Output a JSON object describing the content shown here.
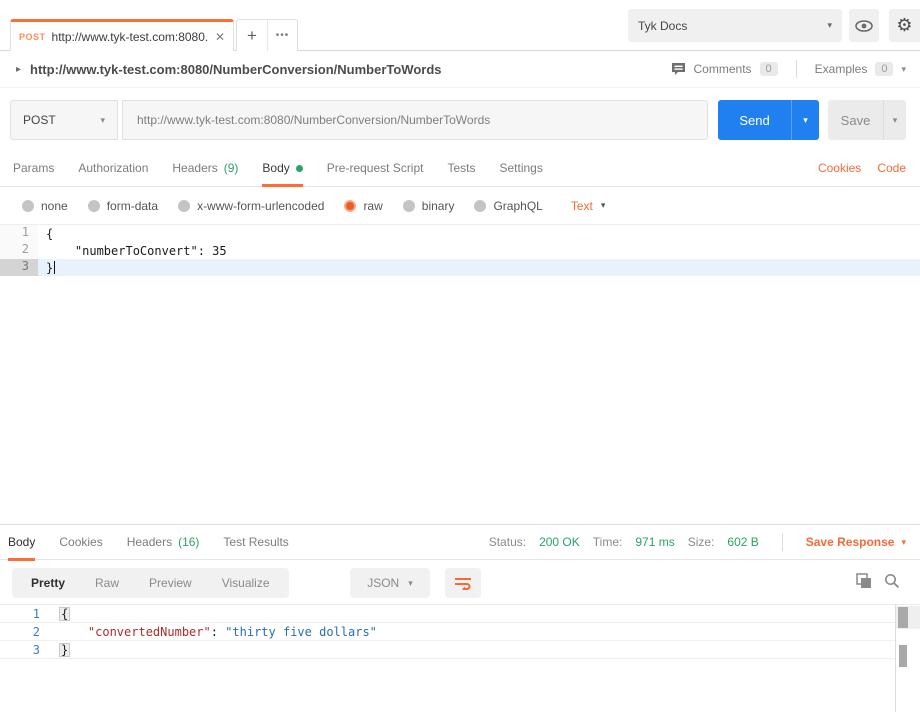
{
  "colors": {
    "accent_orange": "#ff6c37",
    "send_blue": "#2180f0",
    "status_green": "#29a465",
    "json_key_red": "#b22b27",
    "json_string_blue": "#2a6db5",
    "line_number_blue": "#3f7cac"
  },
  "icons": {
    "close": "✕",
    "plus": "+",
    "more": "•••",
    "caret": "▾",
    "arrow": "▸",
    "gear": "⚙"
  },
  "topbar": {
    "tab_method": "POST",
    "tab_title": "http://www.tyk-test.com:8080...",
    "workspace": "Tyk Docs"
  },
  "breadcrumb": {
    "title": "http://www.tyk-test.com:8080/NumberConversion/NumberToWords",
    "comments_label": "Comments",
    "comments_count": "0",
    "examples_label": "Examples",
    "examples_count": "0"
  },
  "request": {
    "method": "POST",
    "url": "http://www.tyk-test.com:8080/NumberConversion/NumberToWords",
    "send": "Send",
    "save": "Save",
    "tabs": [
      {
        "label": "Params"
      },
      {
        "label": "Authorization"
      },
      {
        "label": "Headers",
        "count": "(9)"
      },
      {
        "label": "Body"
      },
      {
        "label": "Pre-request Script"
      },
      {
        "label": "Tests"
      },
      {
        "label": "Settings"
      }
    ],
    "cookies": "Cookies",
    "code": "Code",
    "modes": [
      "none",
      "form-data",
      "x-www-form-urlencoded",
      "raw",
      "binary",
      "GraphQL"
    ],
    "selected_mode": "raw",
    "type": "Text",
    "editor": {
      "line_numbers": [
        "1",
        "2",
        "3"
      ],
      "lines": [
        "{",
        "    \"numberToConvert\": 35",
        "}"
      ]
    }
  },
  "response": {
    "tabs": [
      {
        "label": "Body"
      },
      {
        "label": "Cookies"
      },
      {
        "label": "Headers",
        "count": "(16)"
      },
      {
        "label": "Test Results"
      }
    ],
    "status_label": "Status:",
    "status": "200 OK",
    "time_label": "Time:",
    "time": "971 ms",
    "size_label": "Size:",
    "size": "602 B",
    "save_response": "Save Response",
    "views": [
      "Pretty",
      "Raw",
      "Preview",
      "Visualize"
    ],
    "format": "JSON",
    "editor": {
      "line_numbers": [
        "1",
        "2",
        "3"
      ],
      "l1_brace": "{",
      "l2_indent": "    ",
      "l2_key": "\"convertedNumber\"",
      "l2_sep": ": ",
      "l2_value": "\"thirty five dollars\"",
      "l3_brace": "}"
    }
  }
}
